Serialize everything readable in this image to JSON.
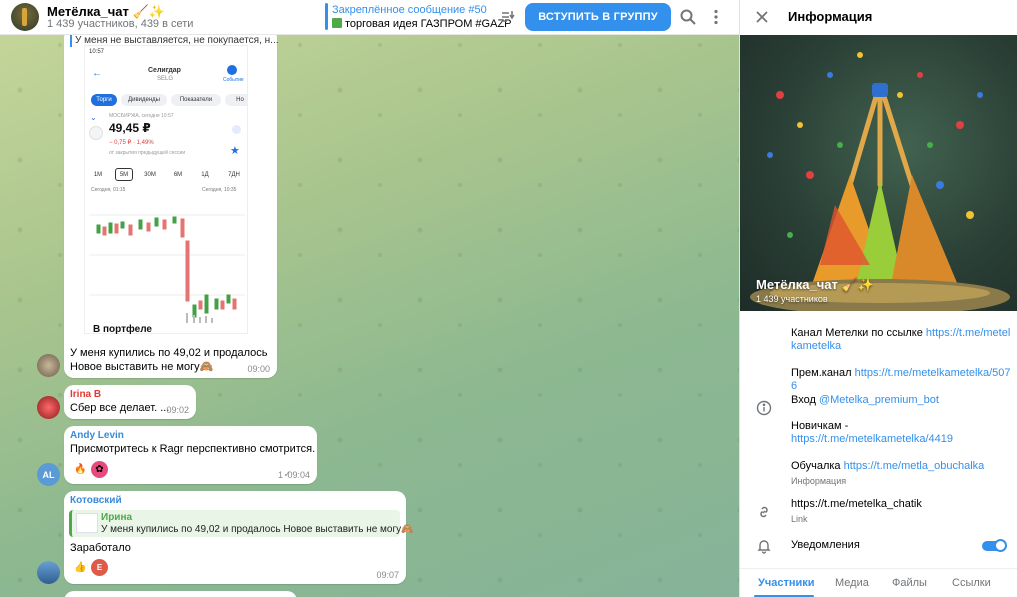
{
  "header": {
    "title": "Метёлка_чат 🧹✨",
    "subtitle": "1 439 участников, 439 в сети",
    "pinned_title": "Закреплённое сообщение #50",
    "pinned_text": "торговая идея ГАЗПРОМ #GAZP",
    "join_label": "ВСТУПИТЬ В ГРУППУ"
  },
  "messages": {
    "m1": {
      "reply_preview": "У меня не выставляется, не покупается, н...",
      "phone": {
        "status_time": "10:57",
        "ticker_name": "Селигдар",
        "ticker_code": "SELG",
        "alerts": "Событие",
        "tabs": [
          "Торги",
          "Дивиденды",
          "Показатели",
          "Но"
        ],
        "exchange": "МОСБИРЖА, сегодня 10:57",
        "price": "49,45 ₽",
        "change": "− 0,75 ₽ · 1,49%",
        "change_note": "от закрытия предыдущей сессии",
        "timeframes": [
          "1М",
          "5М",
          "30М",
          "6М",
          "1Д",
          "7ДН"
        ],
        "chart_left_label": "Сегодня, 01:15",
        "chart_right_label": "Сегодня, 10:35",
        "portfolio": "В портфеле"
      },
      "line1": "У меня купились по 49,02 и продалось",
      "line2": "Новое выставить не могу🙈",
      "time": "09:00"
    },
    "m2": {
      "sender": "Irina B",
      "text": "Сбер все делает. ...",
      "time": "09:02"
    },
    "m3": {
      "sender": "Andy Levin",
      "text": "Присмотритесь к Ragr перспективно смотрится.",
      "avatar": "AL",
      "react_count": "1",
      "time": "09:04"
    },
    "m4": {
      "sender": "Котовский",
      "quote_author": "Ирина",
      "quote_text": "У меня купились по 49,02 и продалось Новое выставить не могу🙈",
      "text": "Заработало",
      "react_letter": "E",
      "time": "09:07"
    }
  },
  "panel": {
    "title": "Информация",
    "channel_name": "Метёлка_чат 🧹✨",
    "members": "1 439 участников",
    "desc1_text": "Канал Метелки по ссылке ",
    "desc1_link": "https://t.me/metelkametelka",
    "desc2_text": "Прем.канал ",
    "desc2_link": "https://t.me/metelkametelka/5076",
    "desc3_text": "Вход ",
    "desc3_link": "@Metelka_premium_bot",
    "desc4_text": "Новичкам -",
    "desc4_link": "https://t.me/metelkametelka/4419",
    "desc5_text": "Обучалка ",
    "desc5_link": "https://t.me/metla_obuchalka",
    "info_caption": "Информация",
    "link_value": "https://t.me/metelka_chatik",
    "link_caption": "Link",
    "notifications_label": "Уведомления",
    "tabs": [
      "Участники",
      "Медиа",
      "Файлы",
      "Ссылки"
    ]
  },
  "colors": {
    "accent": "#3390ec",
    "price_down": "#e53935",
    "candle_up": "#43a047",
    "candle_down": "#e57373"
  },
  "icons": [
    "search-icon",
    "more-icon",
    "pinned-list-icon",
    "close-icon",
    "info-icon",
    "link-icon",
    "bell-icon"
  ]
}
